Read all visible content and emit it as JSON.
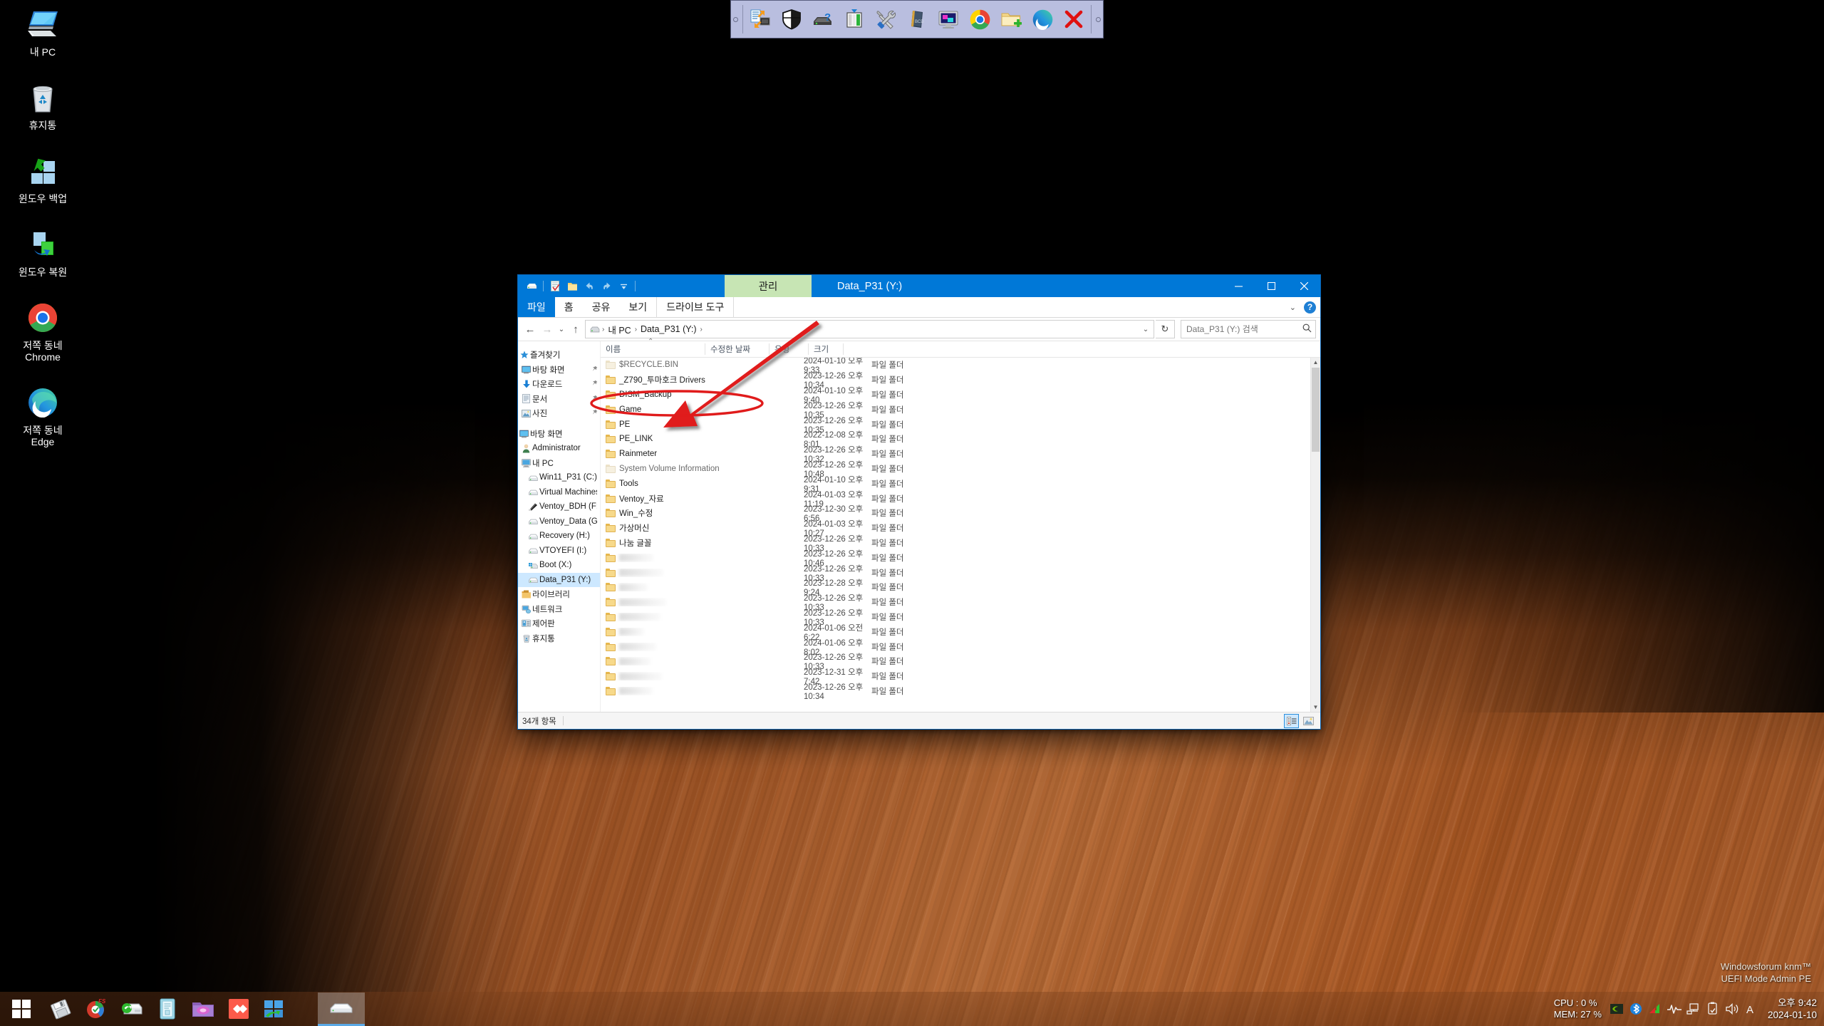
{
  "desktop": {
    "icons": [
      {
        "name": "내 PC",
        "icon": "computer-icon"
      },
      {
        "name": "휴지통",
        "icon": "recycle-bin-icon"
      },
      {
        "name": "윈도우 백업",
        "icon": "windows-backup-icon"
      },
      {
        "name": "윈도우 복원",
        "icon": "windows-restore-icon"
      },
      {
        "name": "저쪽 동네\nChrome",
        "icon": "chrome-icon"
      },
      {
        "name": "저쪽 동네\nEdge",
        "icon": "edge-icon"
      }
    ],
    "watermark": "Windowsforum knm™\nUEFI Mode Admin PE"
  },
  "float_toolbar": {
    "buttons": [
      {
        "name": "remote-desktop-icon",
        "title": "원격 데스크톱"
      },
      {
        "name": "shield-icon",
        "title": "보안"
      },
      {
        "name": "disk-help-icon",
        "title": "디스크 도움말"
      },
      {
        "name": "partition-icon",
        "title": "파티션"
      },
      {
        "name": "tools-icon",
        "title": "도구"
      },
      {
        "name": "notebook-icon",
        "title": "메모장"
      },
      {
        "name": "display-icon",
        "title": "디스플레이"
      },
      {
        "name": "chrome-icon",
        "title": "Chrome"
      },
      {
        "name": "new-folder-icon",
        "title": "새 폴더"
      },
      {
        "name": "edge-icon",
        "title": "Edge"
      },
      {
        "name": "close-icon",
        "title": "닫기"
      }
    ]
  },
  "explorer": {
    "title": "Data_P31 (Y:)",
    "context_tab": "관리",
    "quick_access_buttons": [
      "drive-icon",
      "properties-icon",
      "new-folder-icon",
      "undo-icon",
      "redo-icon",
      "customize-icon"
    ],
    "window_buttons": {
      "minimize": "─",
      "maximize": "▢",
      "close": "✕"
    },
    "ribbon_tabs": [
      {
        "label": "파일",
        "kind": "file"
      },
      {
        "label": "홈",
        "kind": "normal"
      },
      {
        "label": "공유",
        "kind": "normal"
      },
      {
        "label": "보기",
        "kind": "normal"
      },
      {
        "label": "드라이브 도구",
        "kind": "ctx"
      }
    ],
    "ribbon_right": {
      "collapse": "⌄",
      "help": "?"
    },
    "address": {
      "back": "←",
      "forward": "→",
      "recent": "⌄",
      "up": "↑",
      "crumbs": [
        "내 PC",
        "Data_P31 (Y:)"
      ],
      "dropdown": "⌄",
      "refresh": "↻"
    },
    "search": {
      "placeholder": "Data_P31 (Y:) 검색",
      "value": "",
      "icon": "search-icon"
    },
    "nav_pane": [
      {
        "label": "즐겨찾기",
        "icon": "favorites-star-icon",
        "indent": 0,
        "pinned": false
      },
      {
        "label": "바탕 화면",
        "icon": "desktop-icon",
        "indent": 1,
        "pinned": true
      },
      {
        "label": "다운로드",
        "icon": "downloads-icon",
        "indent": 1,
        "pinned": true
      },
      {
        "label": "문서",
        "icon": "documents-icon",
        "indent": 1,
        "pinned": true
      },
      {
        "label": "사진",
        "icon": "pictures-icon",
        "indent": 1,
        "pinned": true
      },
      {
        "label": "GAP",
        "icon": "",
        "indent": 0,
        "pinned": false
      },
      {
        "label": "바탕 화면",
        "icon": "desktop-icon",
        "indent": 0,
        "pinned": false
      },
      {
        "label": "Administrator",
        "icon": "user-icon",
        "indent": 1,
        "pinned": false
      },
      {
        "label": "내 PC",
        "icon": "this-pc-icon",
        "indent": 1,
        "pinned": false
      },
      {
        "label": "Win11_P31 (C:)",
        "icon": "drive-icon",
        "indent": 2,
        "pinned": false
      },
      {
        "label": "Virtual Machines",
        "icon": "drive-icon",
        "indent": 2,
        "pinned": false
      },
      {
        "label": "Ventoy_BDH (F:)",
        "icon": "usb-drive-icon",
        "indent": 2,
        "pinned": false
      },
      {
        "label": "Ventoy_Data (G:)",
        "icon": "drive-icon",
        "indent": 2,
        "pinned": false
      },
      {
        "label": "Recovery (H:)",
        "icon": "drive-icon",
        "indent": 2,
        "pinned": false
      },
      {
        "label": "VTOYEFI (I:)",
        "icon": "drive-icon",
        "indent": 2,
        "pinned": false
      },
      {
        "label": "Boot (X:)",
        "icon": "boot-drive-icon",
        "indent": 2,
        "pinned": false
      },
      {
        "label": "Data_P31 (Y:)",
        "icon": "drive-icon",
        "indent": 2,
        "pinned": false,
        "selected": true
      },
      {
        "label": "라이브러리",
        "icon": "library-icon",
        "indent": 1,
        "pinned": false
      },
      {
        "label": "네트워크",
        "icon": "network-icon",
        "indent": 1,
        "pinned": false
      },
      {
        "label": "제어판",
        "icon": "control-panel-icon",
        "indent": 1,
        "pinned": false
      },
      {
        "label": "휴지통",
        "icon": "recycle-bin-icon",
        "indent": 1,
        "pinned": false
      }
    ],
    "columns": [
      "이름",
      "수정한 날짜",
      "유형",
      "크기"
    ],
    "sort": {
      "column": "이름",
      "direction": "asc",
      "caret": "⌃"
    },
    "files": [
      {
        "name": "$RECYCLE.BIN",
        "date": "2024-01-10 오후 9:33",
        "type": "파일 폴더",
        "size": "",
        "ghost": true,
        "blurred": false
      },
      {
        "name": "_Z790_투마호크 Drivers",
        "date": "2023-12-26 오후 10:34",
        "type": "파일 폴더",
        "size": "",
        "ghost": false,
        "blurred": false
      },
      {
        "name": "DISM_Backup",
        "date": "2024-01-10 오후 9:40",
        "type": "파일 폴더",
        "size": "",
        "ghost": false,
        "blurred": false,
        "highlighted": true
      },
      {
        "name": "Game",
        "date": "2023-12-26 오후 10:35",
        "type": "파일 폴더",
        "size": "",
        "ghost": false,
        "blurred": false
      },
      {
        "name": "PE",
        "date": "2023-12-26 오후 10:35",
        "type": "파일 폴더",
        "size": "",
        "ghost": false,
        "blurred": false
      },
      {
        "name": "PE_LINK",
        "date": "2022-12-08 오후 8:01",
        "type": "파일 폴더",
        "size": "",
        "ghost": false,
        "blurred": false
      },
      {
        "name": "Rainmeter",
        "date": "2023-12-26 오후 10:32",
        "type": "파일 폴더",
        "size": "",
        "ghost": false,
        "blurred": false
      },
      {
        "name": "System Volume Information",
        "date": "2023-12-26 오후 10:48",
        "type": "파일 폴더",
        "size": "",
        "ghost": true,
        "blurred": false
      },
      {
        "name": "Tools",
        "date": "2024-01-10 오후 9:31",
        "type": "파일 폴더",
        "size": "",
        "ghost": false,
        "blurred": false
      },
      {
        "name": "Ventoy_자료",
        "date": "2024-01-03 오후 11:19",
        "type": "파일 폴더",
        "size": "",
        "ghost": false,
        "blurred": false
      },
      {
        "name": "Win_수정",
        "date": "2023-12-30 오후 6:56",
        "type": "파일 폴더",
        "size": "",
        "ghost": false,
        "blurred": false
      },
      {
        "name": "가상머신",
        "date": "2024-01-03 오후 10:27",
        "type": "파일 폴더",
        "size": "",
        "ghost": false,
        "blurred": false
      },
      {
        "name": "나눔 글꼴",
        "date": "2023-12-26 오후 10:33",
        "type": "파일 폴더",
        "size": "",
        "ghost": false,
        "blurred": false
      },
      {
        "name": "",
        "date": "2023-12-26 오후 10:46",
        "type": "파일 폴더",
        "size": "",
        "ghost": false,
        "blurred": true,
        "blur_w": 48
      },
      {
        "name": "",
        "date": "2023-12-26 오후 10:33",
        "type": "파일 폴더",
        "size": "",
        "ghost": false,
        "blurred": true,
        "blur_w": 62
      },
      {
        "name": "",
        "date": "2023-12-28 오후 9:24",
        "type": "파일 폴더",
        "size": "",
        "ghost": false,
        "blurred": true,
        "blur_w": 40
      },
      {
        "name": "",
        "date": "2023-12-26 오후 10:33",
        "type": "파일 폴더",
        "size": "",
        "ghost": false,
        "blurred": true,
        "blur_w": 66
      },
      {
        "name": "",
        "date": "2023-12-26 오후 10:33",
        "type": "파일 폴더",
        "size": "",
        "ghost": false,
        "blurred": true,
        "blur_w": 58
      },
      {
        "name": "",
        "date": "2024-01-06 오전 6:22",
        "type": "파일 폴더",
        "size": "",
        "ghost": false,
        "blurred": true,
        "blur_w": 35
      },
      {
        "name": "",
        "date": "2024-01-06 오후 8:02",
        "type": "파일 폴더",
        "size": "",
        "ghost": false,
        "blurred": true,
        "blur_w": 52
      },
      {
        "name": "",
        "date": "2023-12-26 오후 10:33",
        "type": "파일 폴더",
        "size": "",
        "ghost": false,
        "blurred": true,
        "blur_w": 44
      },
      {
        "name": "",
        "date": "2023-12-31 오후 7:42",
        "type": "파일 폴더",
        "size": "",
        "ghost": false,
        "blurred": true,
        "blur_w": 60
      },
      {
        "name": "",
        "date": "2023-12-26 오후 10:34",
        "type": "파일 폴더",
        "size": "",
        "ghost": false,
        "blurred": true,
        "blur_w": 47
      }
    ],
    "status": {
      "count": "34개 항목"
    },
    "view_buttons": [
      {
        "name": "details-view-icon",
        "active": true
      },
      {
        "name": "large-icons-view-icon",
        "active": false
      }
    ]
  },
  "annotation": {
    "arrow_color": "#e01b1b",
    "ellipse_color": "#e01b1b",
    "target": "DISM_Backup"
  },
  "taskbar": {
    "start": {
      "name": "start-button"
    },
    "items": [
      {
        "name": "floppy-save-icon"
      },
      {
        "name": "partition-wizard-icon"
      },
      {
        "name": "usb-format-icon"
      },
      {
        "name": "notes-icon"
      },
      {
        "name": "media-folder-icon"
      },
      {
        "name": "everything-search-icon"
      },
      {
        "name": "windows-tool-icon"
      }
    ],
    "open_task": {
      "name": "explorer-task",
      "icon": "drive-icon"
    },
    "tray": {
      "cpu_mem": "CPU :   0 %\nMEM: 27 %",
      "icons": [
        "nvidia-icon",
        "bluetooth-icon",
        "amd-icon",
        "heartbeat-icon",
        "network-icon",
        "usb-eject-icon",
        "volume-icon",
        "ime-icon"
      ],
      "clock": "오후 9:42\n2024-01-10"
    }
  }
}
